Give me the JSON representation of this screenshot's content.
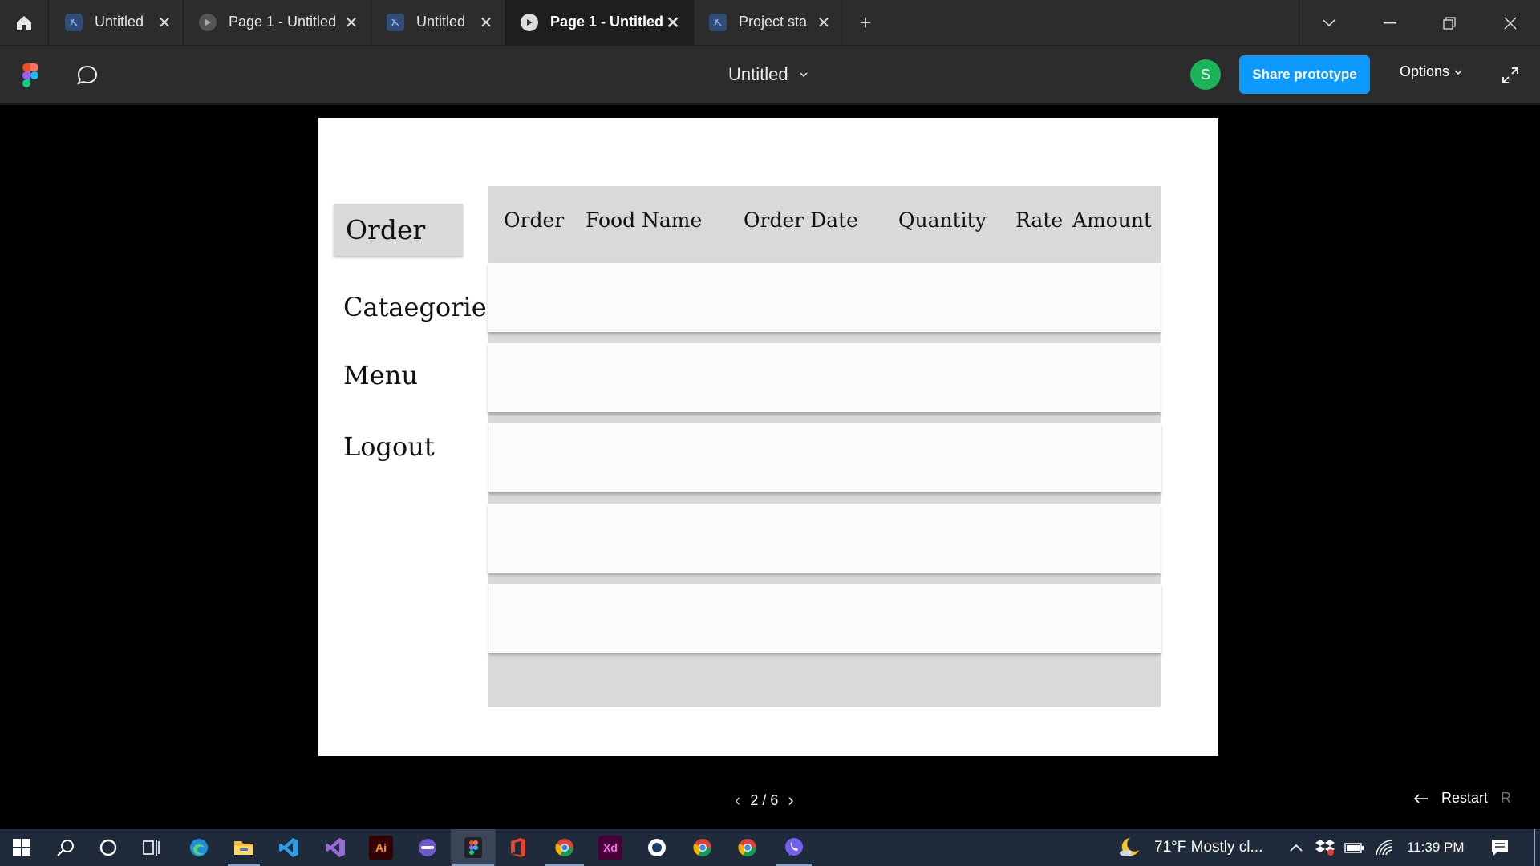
{
  "tabs": [
    {
      "label": "Untitled",
      "icon": "figma-file-icon",
      "active": false
    },
    {
      "label": "Page 1 - Untitled",
      "icon": "play-icon",
      "active": false
    },
    {
      "label": "Untitled",
      "icon": "figma-file-icon",
      "active": false
    },
    {
      "label": "Page 1 - Untitled",
      "icon": "play-icon",
      "active": true
    },
    {
      "label": "Project sta",
      "icon": "figma-file-icon",
      "active": false
    }
  ],
  "toolbar": {
    "doc_title": "Untitled",
    "avatar_initial": "S",
    "share_label": "Share prototype",
    "options_label": "Options"
  },
  "prototype": {
    "sidebar": {
      "selected": "Order",
      "items": [
        "Cataegories",
        "Menu",
        "Logout"
      ]
    },
    "table": {
      "headers": [
        "Order",
        "Food Name",
        "Order Date",
        "Quantity",
        "Rate",
        "Amount"
      ],
      "row_count": 5
    }
  },
  "pager": {
    "label": "2 / 6"
  },
  "restart": {
    "label": "Restart",
    "key": "R"
  },
  "taskbar": {
    "weather": "71°F  Mostly cl...",
    "time": "11:39 PM",
    "apps": [
      "windows-start-icon",
      "search-icon",
      "cortana-icon",
      "task-view-icon",
      "edge-icon",
      "file-explorer-icon",
      "vscode-icon",
      "visual-studio-icon",
      "illustrator-icon",
      "app-icon",
      "figma-icon",
      "office-icon",
      "chrome-icon",
      "xd-icon",
      "app-circle-icon",
      "chrome-icon",
      "chrome-icon",
      "viber-icon"
    ],
    "app_labels": {
      "illustrator": "Ai",
      "xd": "Xd"
    }
  },
  "colors": {
    "accent": "#0d99ff",
    "avatar": "#1bb45a",
    "chrome": "#2c2c2c",
    "table_gray": "#d9d9d9",
    "row_fill": "#fcfbfa"
  }
}
